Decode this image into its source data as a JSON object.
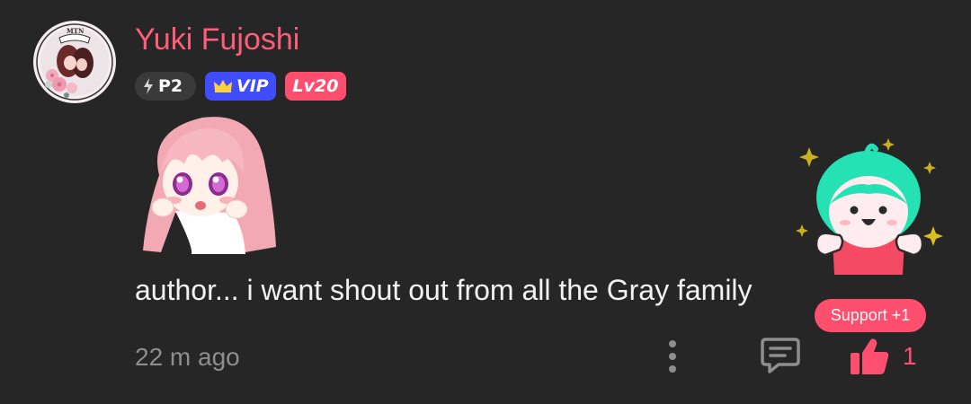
{
  "comment": {
    "user": {
      "name": "Yuki Fujoshi",
      "avatar_text": "MTN",
      "badges": {
        "power": "P2",
        "vip": "VIP",
        "level": "Lv20"
      }
    },
    "text": "author... i want shout out from all the Gray family",
    "timestamp": "22 m ago",
    "support_tooltip": "Support +1",
    "like_count": "1"
  },
  "colors": {
    "background": "#262626",
    "username": "#ff5c79",
    "accent": "#ff4e6e",
    "vip": "#3f4cff",
    "text": "#f2f2f2",
    "muted": "#8e8e8e"
  }
}
